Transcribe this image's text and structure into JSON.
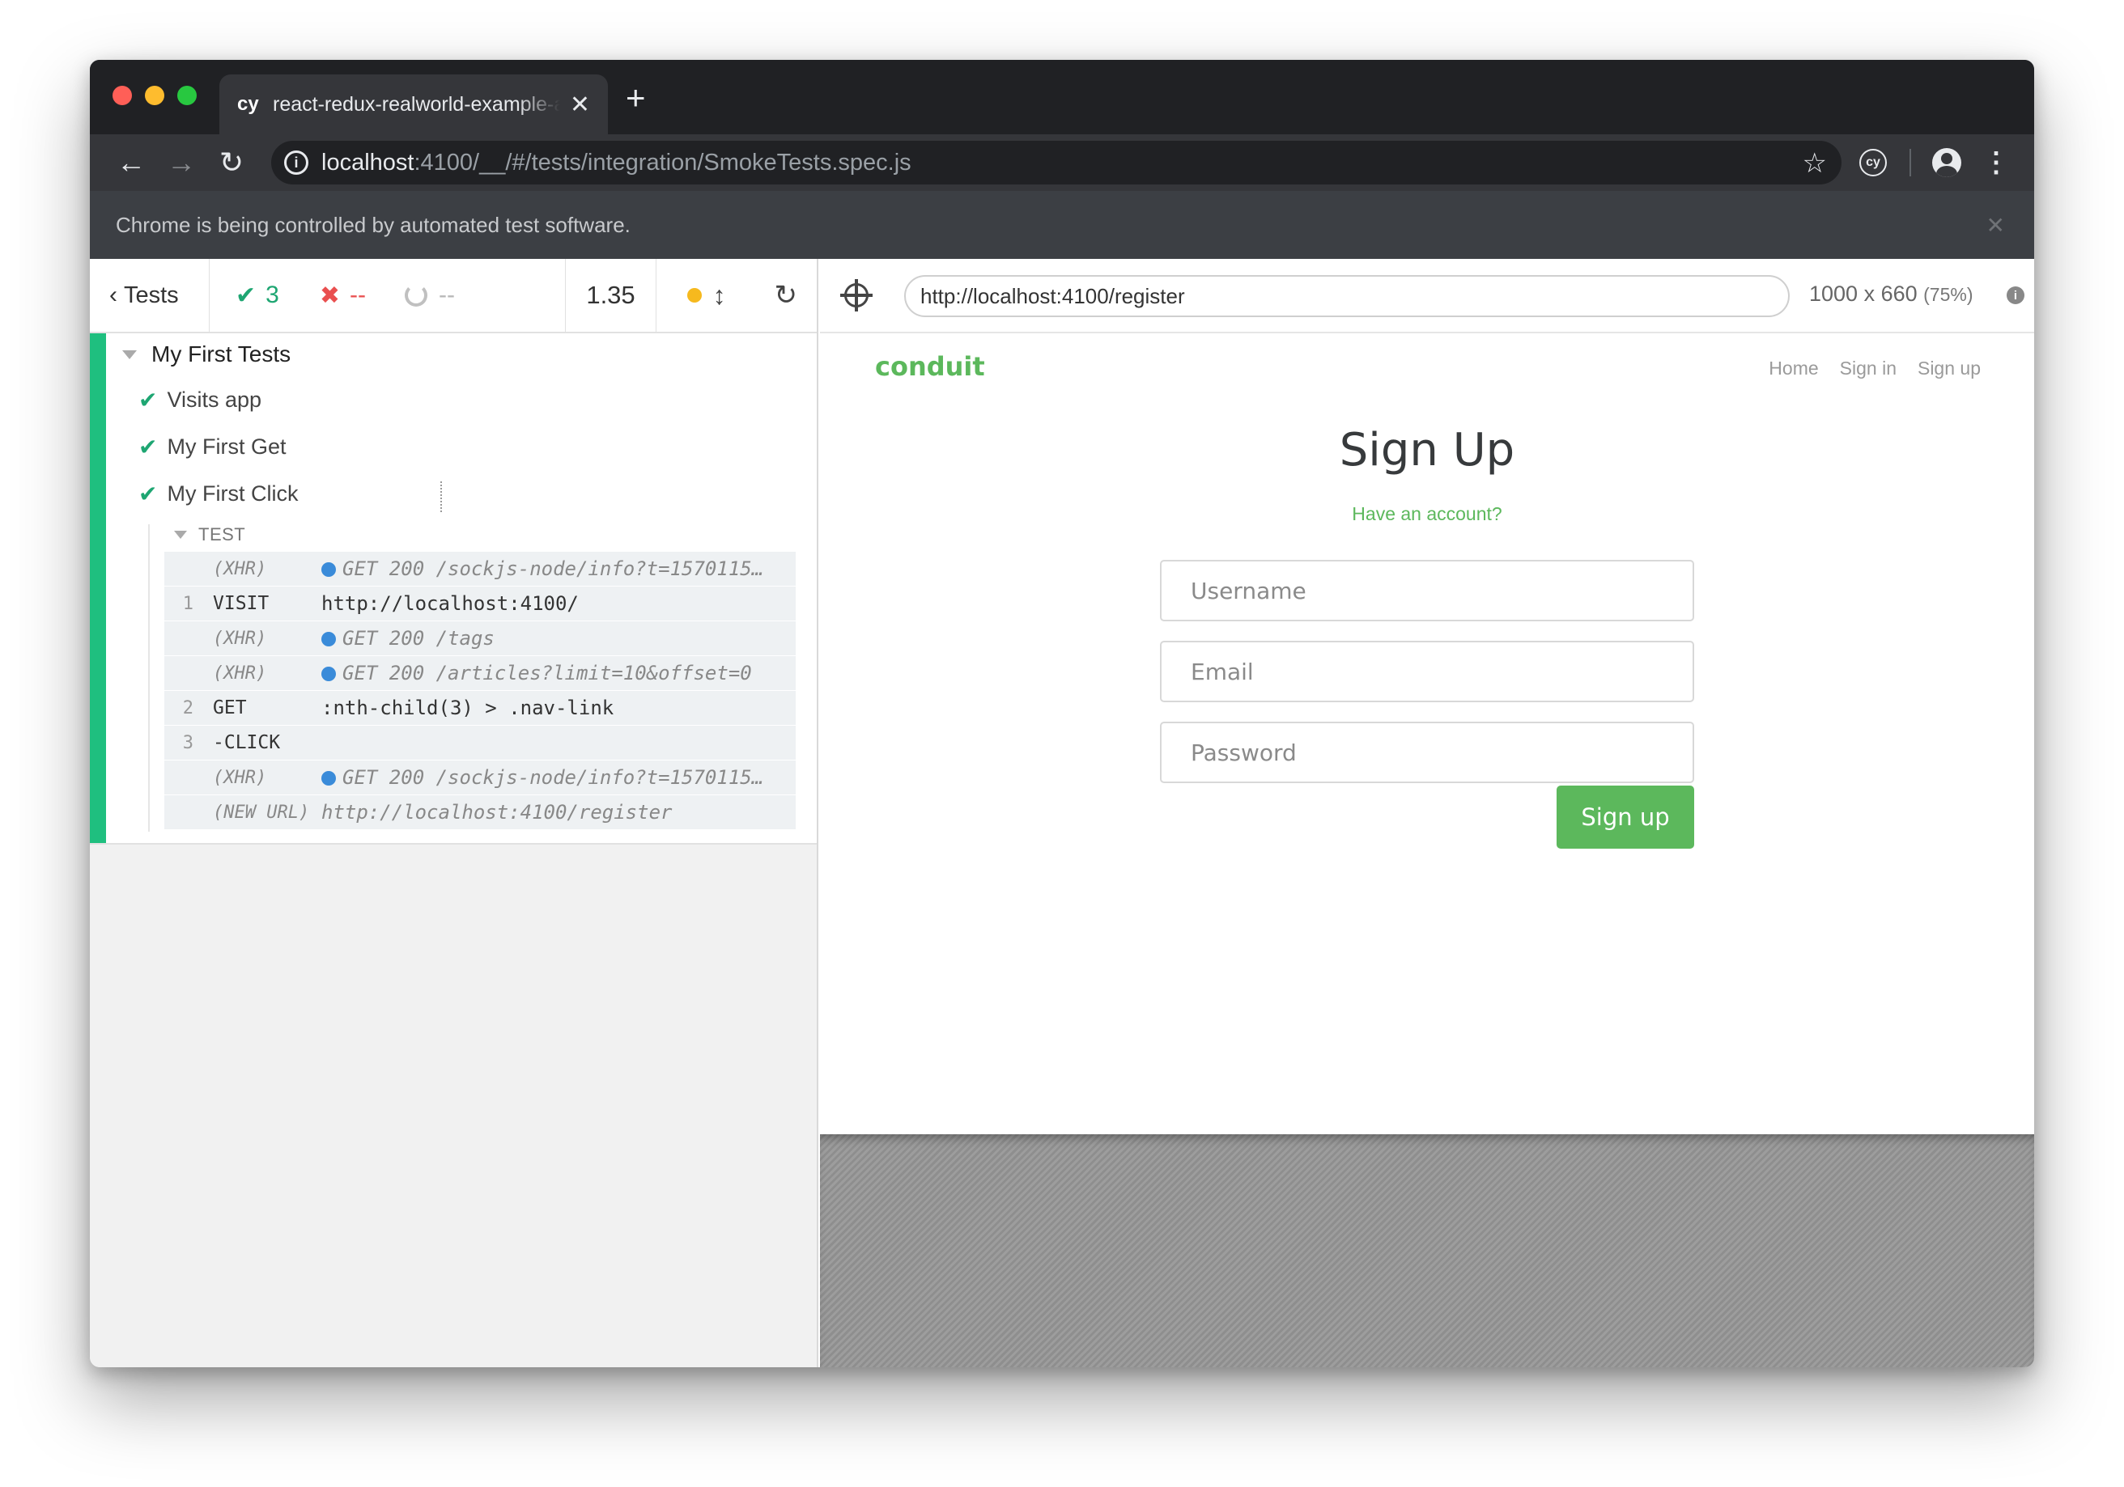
{
  "browser": {
    "tab_favicon": "cy",
    "tab_title": "react-redux-realworld-example-app",
    "tab_close": "✕",
    "new_tab": "+",
    "url_host": "localhost",
    "url_rest": ":4100/__/#/tests/integration/SmokeTests.spec.js",
    "ext_label": "cy",
    "infobar_text": "Chrome is being controlled by automated test software.",
    "infobar_close": "✕"
  },
  "runner": {
    "tests_label": "Tests",
    "passed": "3",
    "failed": "--",
    "pending": "--",
    "duration": "1.35",
    "suite": "My First Tests",
    "tests": [
      "Visits app",
      "My First Get",
      "My First Click"
    ],
    "test_section": "TEST",
    "commands": [
      {
        "num": "",
        "name": "(XHR)",
        "msg": "GET 200 /sockjs-node/info?t=1570115…",
        "event": true,
        "dot": true
      },
      {
        "num": "1",
        "name": "VISIT",
        "msg": "http://localhost:4100/",
        "event": false,
        "dot": false
      },
      {
        "num": "",
        "name": "(XHR)",
        "msg": "GET 200 /tags",
        "event": true,
        "dot": true
      },
      {
        "num": "",
        "name": "(XHR)",
        "msg": "GET 200 /articles?limit=10&offset=0",
        "event": true,
        "dot": true
      },
      {
        "num": "2",
        "name": "GET",
        "msg": ":nth-child(3) > .nav-link",
        "event": false,
        "dot": false
      },
      {
        "num": "3",
        "name": "-CLICK",
        "msg": "",
        "event": false,
        "dot": false
      },
      {
        "num": "",
        "name": "(XHR)",
        "msg": "GET 200 /sockjs-node/info?t=1570115…",
        "event": true,
        "dot": true
      },
      {
        "num": "",
        "name": "(NEW URL)",
        "msg": "http://localhost:4100/register",
        "event": true,
        "dot": false
      }
    ]
  },
  "aut": {
    "url": "http://localhost:4100/register",
    "viewport": "1000 x 660",
    "scale": "(75%)"
  },
  "app": {
    "brand": "conduit",
    "nav": [
      "Home",
      "Sign in",
      "Sign up"
    ],
    "title": "Sign Up",
    "have_account": "Have an account?",
    "username_placeholder": "Username",
    "email_placeholder": "Email",
    "password_placeholder": "Password",
    "submit_label": "Sign up",
    "brand_color": "#5cb85c"
  }
}
